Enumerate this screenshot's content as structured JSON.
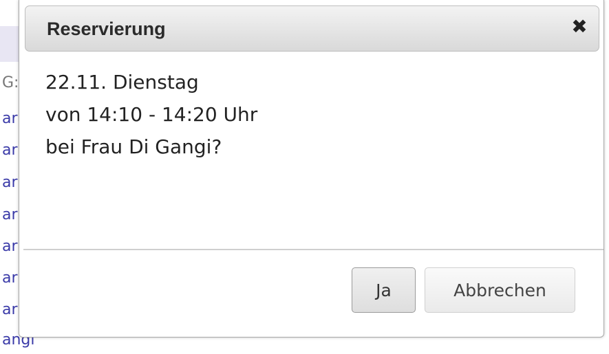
{
  "background": {
    "rows": [
      "G:",
      "ar",
      "ar",
      "ar",
      "ar",
      "ar",
      "ar",
      "ar",
      "angi"
    ]
  },
  "dialog": {
    "title": "Reservierung",
    "close_glyph": "✖",
    "close_icon": "close-icon",
    "lines": [
      "22.11. Dienstag",
      "von 14:10 - 14:20 Uhr",
      "bei Frau Di Gangi?"
    ],
    "buttons": {
      "confirm_label": "Ja",
      "cancel_label": "Abbrechen"
    }
  }
}
